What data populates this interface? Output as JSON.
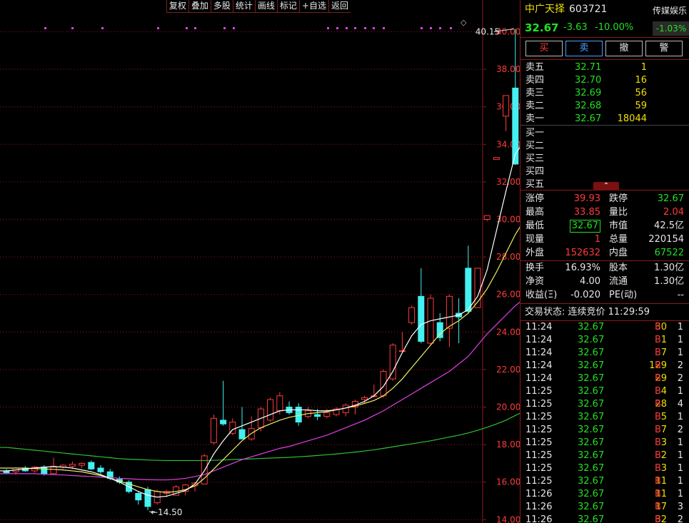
{
  "toolbar": {
    "buttons": [
      "复权",
      "叠加",
      "多股",
      "统计",
      "画线",
      "标记",
      "+自选",
      "返回"
    ]
  },
  "header": {
    "name": "中广天择",
    "code": "603721",
    "price": "32.67",
    "change": "-3.63",
    "change_pct": "-10.00%",
    "sector": "传媒娱乐",
    "sector_pct": "-1.03%"
  },
  "actions": [
    "买",
    "卖",
    "撤",
    "警"
  ],
  "sell_levels": [
    {
      "label": "卖五",
      "price": "32.71",
      "vol": "1"
    },
    {
      "label": "卖四",
      "price": "32.70",
      "vol": "16"
    },
    {
      "label": "卖三",
      "price": "32.69",
      "vol": "56"
    },
    {
      "label": "卖二",
      "price": "32.68",
      "vol": "59"
    },
    {
      "label": "卖一",
      "price": "32.67",
      "vol": "18044"
    }
  ],
  "buy_levels": [
    {
      "label": "买一"
    },
    {
      "label": "买二"
    },
    {
      "label": "买三"
    },
    {
      "label": "买四"
    },
    {
      "label": "买五"
    }
  ],
  "collapse_icon": "chevron-up-icon",
  "stats": {
    "rows": [
      {
        "l1": "涨停",
        "v1": "39.93",
        "l2": "跌停",
        "v2": "32.67"
      },
      {
        "l1": "最高",
        "v1": "33.85",
        "l2": "量比",
        "v2": "2.04"
      },
      {
        "l1": "最低",
        "v1": "32.67",
        "l2": "市值",
        "v2": "42.5亿"
      },
      {
        "l1": "现量",
        "v1": "1",
        "l2": "总量",
        "v2": "220154"
      },
      {
        "l1": "外盘",
        "v1": "152632",
        "l2": "内盘",
        "v2": "67522"
      }
    ],
    "rows2": [
      {
        "l1": "换手",
        "v1": "16.93%",
        "l2": "股本",
        "v2": "1.30亿"
      },
      {
        "l1": "净资",
        "v1": "4.00",
        "l2": "流通",
        "v2": "1.30亿"
      },
      {
        "l1": "收益(Ξ)",
        "v1": "-0.020",
        "l2": "PE(动)",
        "v2": "--"
      }
    ]
  },
  "trade_status": {
    "label": "交易状态: 连续竞价 11:29:59"
  },
  "ticks": [
    {
      "time": "11:24",
      "price": "32.67",
      "vol": "30",
      "side": "B",
      "n": "1"
    },
    {
      "time": "11:24",
      "price": "32.67",
      "vol": "1",
      "side": "B",
      "n": "1"
    },
    {
      "time": "11:24",
      "price": "32.67",
      "vol": "7",
      "side": "B",
      "n": "1"
    },
    {
      "time": "11:24",
      "price": "32.67",
      "vol": "129",
      "side": "B",
      "n": "2"
    },
    {
      "time": "11:24",
      "price": "32.67",
      "vol": "29",
      "side": "B",
      "n": "2"
    },
    {
      "time": "11:25",
      "price": "32.67",
      "vol": "4",
      "side": "B",
      "n": "1"
    },
    {
      "time": "11:25",
      "price": "32.67",
      "vol": "28",
      "side": "B",
      "n": "4"
    },
    {
      "time": "11:25",
      "price": "32.67",
      "vol": "5",
      "side": "B",
      "n": "1"
    },
    {
      "time": "11:25",
      "price": "32.67",
      "vol": "7",
      "side": "B",
      "n": "2"
    },
    {
      "time": "11:25",
      "price": "32.67",
      "vol": "3",
      "side": "B",
      "n": "1"
    },
    {
      "time": "11:25",
      "price": "32.67",
      "vol": "2",
      "side": "B",
      "n": "1"
    },
    {
      "time": "11:25",
      "price": "32.67",
      "vol": "3",
      "side": "B",
      "n": "1"
    },
    {
      "time": "11:25",
      "price": "32.67",
      "vol": "11",
      "side": "B",
      "n": "1"
    },
    {
      "time": "11:26",
      "price": "32.67",
      "vol": "11",
      "side": "B",
      "n": "1"
    },
    {
      "time": "11:26",
      "price": "32.67",
      "vol": "17",
      "side": "B",
      "n": "3"
    },
    {
      "time": "11:26",
      "price": "32.67",
      "vol": "32",
      "side": "B",
      "n": "2"
    }
  ],
  "colors": {
    "up": "#ff3b3b",
    "down": "#44f0f0",
    "ma5": "#ffffff",
    "ma10": "#f0f060",
    "ma20": "#e040e0",
    "ma60": "#30c030",
    "grid": "#8b1a1a",
    "axis_text": "#ff3b3b",
    "marker": "#e040e0"
  },
  "chart_data": {
    "type": "candlestick",
    "y_ticks": [
      "40.00",
      "38.00",
      "36.00",
      "34.00",
      "32.00",
      "30.00",
      "28.00",
      "26.00",
      "24.00",
      "22.00",
      "20.00",
      "18.00",
      "16.00",
      "14.00"
    ],
    "ylim": [
      14,
      40.6
    ],
    "annotations": {
      "high": "40.15",
      "low": "14.50"
    },
    "candles": [
      {
        "o": 16.6,
        "h": 16.7,
        "l": 16.45,
        "c": 16.5
      },
      {
        "o": 16.55,
        "h": 16.8,
        "l": 16.4,
        "c": 16.75
      },
      {
        "o": 16.75,
        "h": 16.85,
        "l": 16.55,
        "c": 16.6
      },
      {
        "o": 16.6,
        "h": 16.85,
        "l": 16.5,
        "c": 16.8
      },
      {
        "o": 16.8,
        "h": 16.9,
        "l": 16.35,
        "c": 16.45
      },
      {
        "o": 16.45,
        "h": 17.3,
        "l": 16.4,
        "c": 16.85
      },
      {
        "o": 16.8,
        "h": 16.95,
        "l": 16.7,
        "c": 16.9
      },
      {
        "o": 16.85,
        "h": 17.1,
        "l": 16.7,
        "c": 16.95
      },
      {
        "o": 16.9,
        "h": 17.05,
        "l": 16.75,
        "c": 17.0
      },
      {
        "o": 17.05,
        "h": 17.15,
        "l": 16.65,
        "c": 16.7
      },
      {
        "o": 16.75,
        "h": 16.9,
        "l": 16.45,
        "c": 16.55
      },
      {
        "o": 16.55,
        "h": 16.7,
        "l": 16.1,
        "c": 16.2
      },
      {
        "o": 16.15,
        "h": 16.3,
        "l": 15.9,
        "c": 16.0
      },
      {
        "o": 16.0,
        "h": 16.1,
        "l": 15.4,
        "c": 15.5
      },
      {
        "o": 15.4,
        "h": 15.5,
        "l": 14.8,
        "c": 15.05
      },
      {
        "o": 15.6,
        "h": 15.75,
        "l": 14.5,
        "c": 14.7
      },
      {
        "o": 14.9,
        "h": 15.6,
        "l": 14.8,
        "c": 15.5
      },
      {
        "o": 15.4,
        "h": 15.6,
        "l": 15.2,
        "c": 15.5
      },
      {
        "o": 15.3,
        "h": 15.85,
        "l": 15.3,
        "c": 15.75
      },
      {
        "o": 15.5,
        "h": 15.9,
        "l": 15.3,
        "c": 15.85
      },
      {
        "o": 15.8,
        "h": 16.0,
        "l": 15.5,
        "c": 15.95
      },
      {
        "o": 15.9,
        "h": 17.5,
        "l": 15.9,
        "c": 17.4
      },
      {
        "o": 18.1,
        "h": 19.6,
        "l": 18.0,
        "c": 19.4
      },
      {
        "o": 19.3,
        "h": 21.4,
        "l": 19.0,
        "c": 19.1
      },
      {
        "o": 18.6,
        "h": 19.4,
        "l": 18.5,
        "c": 19.2
      },
      {
        "o": 18.8,
        "h": 20.0,
        "l": 18.6,
        "c": 18.3
      },
      {
        "o": 18.3,
        "h": 19.5,
        "l": 18.2,
        "c": 18.85
      },
      {
        "o": 18.9,
        "h": 20.0,
        "l": 18.7,
        "c": 19.9
      },
      {
        "o": 19.3,
        "h": 20.5,
        "l": 19.2,
        "c": 20.4
      },
      {
        "o": 19.8,
        "h": 20.8,
        "l": 19.6,
        "c": 20.6
      },
      {
        "o": 20.0,
        "h": 20.3,
        "l": 19.6,
        "c": 19.7
      },
      {
        "o": 20.0,
        "h": 20.2,
        "l": 19.0,
        "c": 19.2
      },
      {
        "o": 19.5,
        "h": 20.0,
        "l": 19.4,
        "c": 19.8
      },
      {
        "o": 19.6,
        "h": 19.9,
        "l": 19.3,
        "c": 19.5
      },
      {
        "o": 19.5,
        "h": 19.9,
        "l": 19.4,
        "c": 19.7
      },
      {
        "o": 19.6,
        "h": 20.0,
        "l": 19.5,
        "c": 19.9
      },
      {
        "o": 19.7,
        "h": 20.2,
        "l": 19.5,
        "c": 20.1
      },
      {
        "o": 20.0,
        "h": 20.4,
        "l": 19.6,
        "c": 20.3
      },
      {
        "o": 20.4,
        "h": 20.6,
        "l": 20.2,
        "c": 20.5
      },
      {
        "o": 20.6,
        "h": 21.2,
        "l": 20.5,
        "c": 20.6
      },
      {
        "o": 20.6,
        "h": 22.0,
        "l": 20.5,
        "c": 21.9
      },
      {
        "o": 21.5,
        "h": 23.4,
        "l": 21.4,
        "c": 23.3
      },
      {
        "o": 23.0,
        "h": 24.0,
        "l": 22.9,
        "c": 23.0
      },
      {
        "o": 24.5,
        "h": 25.4,
        "l": 24.4,
        "c": 25.3
      },
      {
        "o": 25.9,
        "h": 27.4,
        "l": 23.4,
        "c": 23.5
      },
      {
        "o": 23.4,
        "h": 26.0,
        "l": 23.3,
        "c": 25.8
      },
      {
        "o": 24.5,
        "h": 25.0,
        "l": 23.5,
        "c": 23.7
      },
      {
        "o": 24.2,
        "h": 26.0,
        "l": 23.2,
        "c": 25.9
      },
      {
        "o": 25.0,
        "h": 25.8,
        "l": 23.4,
        "c": 24.8
      },
      {
        "o": 27.4,
        "h": 28.6,
        "l": 25.0,
        "c": 25.1
      },
      {
        "o": 25.3,
        "h": 27.4,
        "l": 25.3,
        "c": 27.4
      },
      {
        "o": 30.0,
        "h": 30.2,
        "l": 29.9,
        "c": 30.2
      },
      {
        "o": 33.2,
        "h": 33.3,
        "l": 33.2,
        "c": 33.3
      },
      {
        "o": 35.5,
        "h": 36.6,
        "l": 34.7,
        "c": 36.6
      },
      {
        "o": 37.0,
        "h": 40.15,
        "l": 32.9,
        "c": 32.95
      },
      {
        "o": 33.0,
        "h": 36.25,
        "l": 32.9,
        "c": 36.25
      },
      {
        "o": 32.9,
        "h": 33.8,
        "l": 32.67,
        "c": 32.67
      }
    ],
    "ma5": [
      16.6,
      16.65,
      16.7,
      16.75,
      16.8,
      16.82,
      16.8,
      16.75,
      16.65,
      16.55,
      16.4,
      16.2,
      16.0,
      15.75,
      15.5,
      15.3,
      15.2,
      15.25,
      15.4,
      15.55,
      15.9,
      16.6,
      17.5,
      18.2,
      18.8,
      19.0,
      19.2,
      19.4,
      19.6,
      19.8,
      19.85,
      19.85,
      19.85,
      19.8,
      19.8,
      19.85,
      19.95,
      20.1,
      20.3,
      20.6,
      21.1,
      21.9,
      22.9,
      23.8,
      24.4,
      24.6,
      24.7,
      24.8,
      24.9,
      25.2,
      25.9,
      27.3,
      29.4,
      31.5,
      33.5,
      34.2,
      33.6
    ],
    "ma10": [
      16.75,
      16.75,
      16.75,
      16.72,
      16.7,
      16.68,
      16.65,
      16.6,
      16.55,
      16.45,
      16.35,
      16.2,
      16.05,
      15.9,
      15.75,
      15.6,
      15.5,
      15.45,
      15.5,
      15.6,
      15.8,
      16.2,
      16.7,
      17.2,
      17.7,
      18.2,
      18.6,
      18.9,
      19.1,
      19.3,
      19.45,
      19.55,
      19.65,
      19.7,
      19.75,
      19.85,
      19.95,
      20.05,
      20.2,
      20.35,
      20.6,
      21.0,
      21.5,
      22.1,
      22.7,
      23.3,
      23.9,
      24.3,
      24.6,
      25.0,
      25.6,
      26.3,
      27.2,
      28.2,
      29.2,
      30.0,
      30.5
    ],
    "ma20": [
      16.45,
      16.45,
      16.45,
      16.45,
      16.42,
      16.4,
      16.38,
      16.35,
      16.32,
      16.3,
      16.27,
      16.24,
      16.2,
      16.18,
      16.15,
      16.13,
      16.12,
      16.12,
      16.15,
      16.2,
      16.3,
      16.4,
      16.6,
      16.8,
      17.0,
      17.2,
      17.35,
      17.5,
      17.65,
      17.8,
      17.9,
      18.05,
      18.2,
      18.35,
      18.5,
      18.7,
      18.9,
      19.1,
      19.3,
      19.55,
      19.8,
      20.1,
      20.4,
      20.7,
      21.0,
      21.3,
      21.6,
      21.9,
      22.3,
      22.7,
      23.3,
      23.9,
      24.4,
      24.9,
      25.4,
      25.8,
      26.2
    ],
    "ma60": [
      17.85,
      17.8,
      17.75,
      17.7,
      17.65,
      17.6,
      17.55,
      17.5,
      17.45,
      17.4,
      17.35,
      17.3,
      17.25,
      17.22,
      17.2,
      17.18,
      17.16,
      17.15,
      17.15,
      17.15,
      17.15,
      17.15,
      17.16,
      17.18,
      17.2,
      17.22,
      17.24,
      17.26,
      17.28,
      17.3,
      17.32,
      17.35,
      17.38,
      17.42,
      17.46,
      17.5,
      17.55,
      17.6,
      17.66,
      17.72,
      17.8,
      17.88,
      17.96,
      18.04,
      18.12,
      18.2,
      18.3,
      18.4,
      18.5,
      18.62,
      18.76,
      18.92,
      19.1,
      19.3,
      19.55,
      19.8,
      20.05
    ]
  }
}
